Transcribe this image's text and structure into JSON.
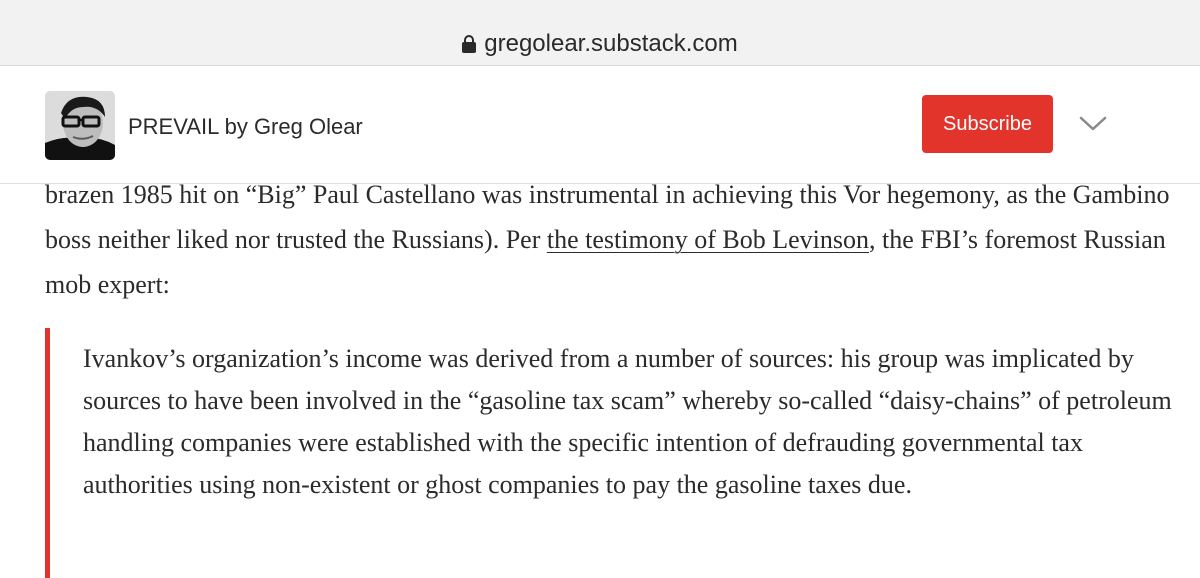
{
  "browser": {
    "url": "gregolear.substack.com",
    "lock_icon": "lock-icon"
  },
  "header": {
    "publication_title": "PREVAIL by Greg Olear",
    "subscribe_label": "Subscribe",
    "menu_icon": "chevron-down-icon",
    "avatar": "author-photo",
    "accent_color": "#e3342b"
  },
  "article": {
    "para_part1": "brazen 1985 hit on “Big” Paul Castellano was instrumental in achieving this Vor hegemony, as the Gambino boss neither liked nor trusted the Russians). Per ",
    "link_text": "the testimony of Bob Levinson",
    "para_part2": ", the FBI’s foremost Russian mob expert:",
    "quote": "Ivankov’s organization’s income was derived from a number of sources: his group was implicated by sources to have been involved in the “gasoline tax scam” whereby so-called “daisy-chains” of petroleum handling companies were established with the specific intention of defrauding governmental tax authorities using non-existent or ghost companies to pay the gasoline taxes due."
  }
}
